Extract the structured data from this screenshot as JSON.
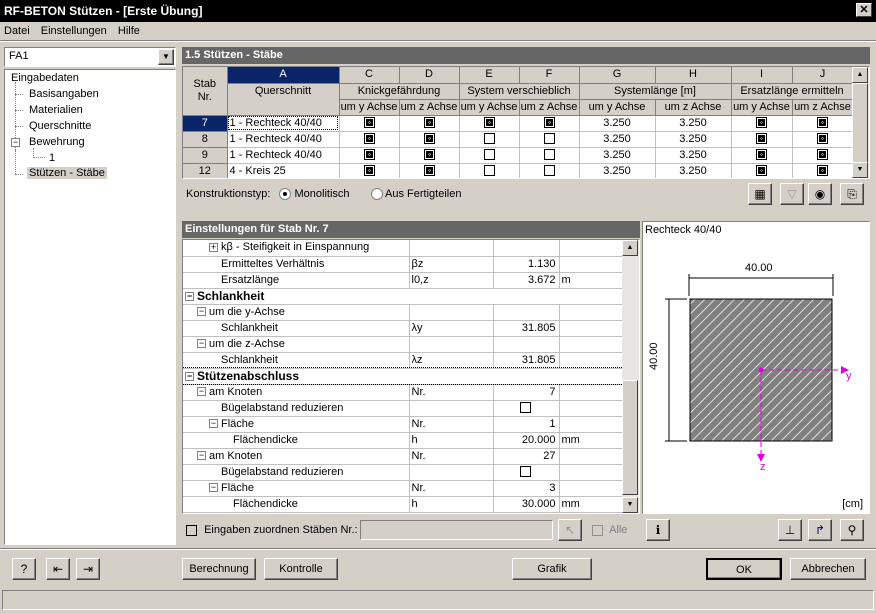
{
  "window": {
    "title": "RF-BETON Stützen - [Erste Übung]",
    "close_label": "✕"
  },
  "menu": {
    "items": [
      "Datei",
      "Einstellungen",
      "Hilfe"
    ]
  },
  "case_select": {
    "value": "FA1"
  },
  "tree": {
    "root": "Eingabedaten",
    "items": [
      "Basisangaben",
      "Materialien",
      "Querschnitte",
      "Bewehrung",
      "1",
      "Stützen - Stäbe"
    ]
  },
  "table_panel": {
    "title": "1.5 Stützen - Stäbe",
    "col_letters": [
      "A",
      "C",
      "D",
      "E",
      "F",
      "G",
      "H",
      "I",
      "J"
    ],
    "stab_header": [
      "Stab",
      "Nr."
    ],
    "groups": [
      "Querschnitt",
      "Knickgefährdung",
      "System verschieblich",
      "Systemlänge [m]",
      "Ersatzlänge ermitteln"
    ],
    "sub": [
      "um y Achse",
      "um z Achse",
      "um y Achse",
      "um z Achse",
      "um y Achse",
      "um z Achse",
      "um y Achse",
      "um z Achse"
    ],
    "rows": [
      {
        "nr": "7",
        "qs": "1 - Rechteck 40/40",
        "c": true,
        "d": true,
        "e": true,
        "f": true,
        "g": "3.250",
        "h": "3.250",
        "i": true,
        "j": true
      },
      {
        "nr": "8",
        "qs": "1 - Rechteck 40/40",
        "c": true,
        "d": true,
        "e": false,
        "f": false,
        "g": "3.250",
        "h": "3.250",
        "i": true,
        "j": true
      },
      {
        "nr": "9",
        "qs": "1 - Rechteck 40/40",
        "c": true,
        "d": true,
        "e": false,
        "f": false,
        "g": "3.250",
        "h": "3.250",
        "i": true,
        "j": true
      },
      {
        "nr": "12",
        "qs": "4 - Kreis 25",
        "c": true,
        "d": true,
        "e": false,
        "f": false,
        "g": "3.250",
        "h": "3.250",
        "i": true,
        "j": true
      }
    ],
    "selected_row": 0
  },
  "konstruktion": {
    "label": "Konstruktionstyp:",
    "opt1": "Monolitisch",
    "opt2": "Aus Fertigteilen",
    "selected": "Monolitisch"
  },
  "settings": {
    "title": "Einstellungen für Stab Nr. 7",
    "rows": [
      {
        "label": "kβ - Steifigkeit in Einspannung",
        "sym": "",
        "val": "",
        "unit": "",
        "indent": 2,
        "toggle": "+"
      },
      {
        "label": "Ermitteltes Verhältnis",
        "sym": "βz",
        "val": "1.130",
        "unit": "",
        "indent": 3
      },
      {
        "label": "Ersatzlänge",
        "sym": "l0,z",
        "val": "3.672",
        "unit": "m",
        "indent": 3
      },
      {
        "label": "Schlankheit",
        "sym": "",
        "val": "",
        "unit": "",
        "indent": 0,
        "toggle": "−",
        "bold": true
      },
      {
        "label": "um die y-Achse",
        "sym": "",
        "val": "",
        "unit": "",
        "indent": 1,
        "toggle": "−"
      },
      {
        "label": "Schlankheit",
        "sym": "λy",
        "val": "31.805",
        "unit": "",
        "indent": 3
      },
      {
        "label": "um die z-Achse",
        "sym": "",
        "val": "",
        "unit": "",
        "indent": 1,
        "toggle": "−"
      },
      {
        "label": "Schlankheit",
        "sym": "λz",
        "val": "31.805",
        "unit": "",
        "indent": 3
      },
      {
        "label": "Stützenabschluss",
        "sym": "",
        "val": "",
        "unit": "",
        "indent": 0,
        "toggle": "−",
        "bold": true
      },
      {
        "label": "am Knoten",
        "sym": "Nr.",
        "val": "7",
        "unit": "",
        "indent": 1,
        "toggle": "−"
      },
      {
        "label": "Bügelabstand reduzieren",
        "sym": "",
        "val": "",
        "unit": "",
        "indent": 3,
        "check": true
      },
      {
        "label": "Fläche",
        "sym": "Nr.",
        "val": "1",
        "unit": "",
        "indent": 2,
        "toggle": "−"
      },
      {
        "label": "Flächendicke",
        "sym": "h",
        "val": "20.000",
        "unit": "mm",
        "indent": 4
      },
      {
        "label": "am Knoten",
        "sym": "Nr.",
        "val": "27",
        "unit": "",
        "indent": 1,
        "toggle": "−"
      },
      {
        "label": "Bügelabstand reduzieren",
        "sym": "",
        "val": "",
        "unit": "",
        "indent": 3,
        "check": true
      },
      {
        "label": "Fläche",
        "sym": "Nr.",
        "val": "3",
        "unit": "",
        "indent": 2,
        "toggle": "−"
      },
      {
        "label": "Flächendicke",
        "sym": "h",
        "val": "30.000",
        "unit": "mm",
        "indent": 4
      }
    ],
    "assign_label": "Eingaben zuordnen Stäben Nr.:",
    "alle_label": "Alle"
  },
  "preview": {
    "title": "Rechteck 40/40",
    "width_dim": "40.00",
    "height_dim": "40.00",
    "axis_y": "y",
    "axis_z": "z",
    "unit": "[cm]"
  },
  "buttons": {
    "berechnung": "Berechnung",
    "kontrolle": "Kontrolle",
    "grafik": "Grafik",
    "ok": "OK",
    "abbrechen": "Abbrechen"
  }
}
